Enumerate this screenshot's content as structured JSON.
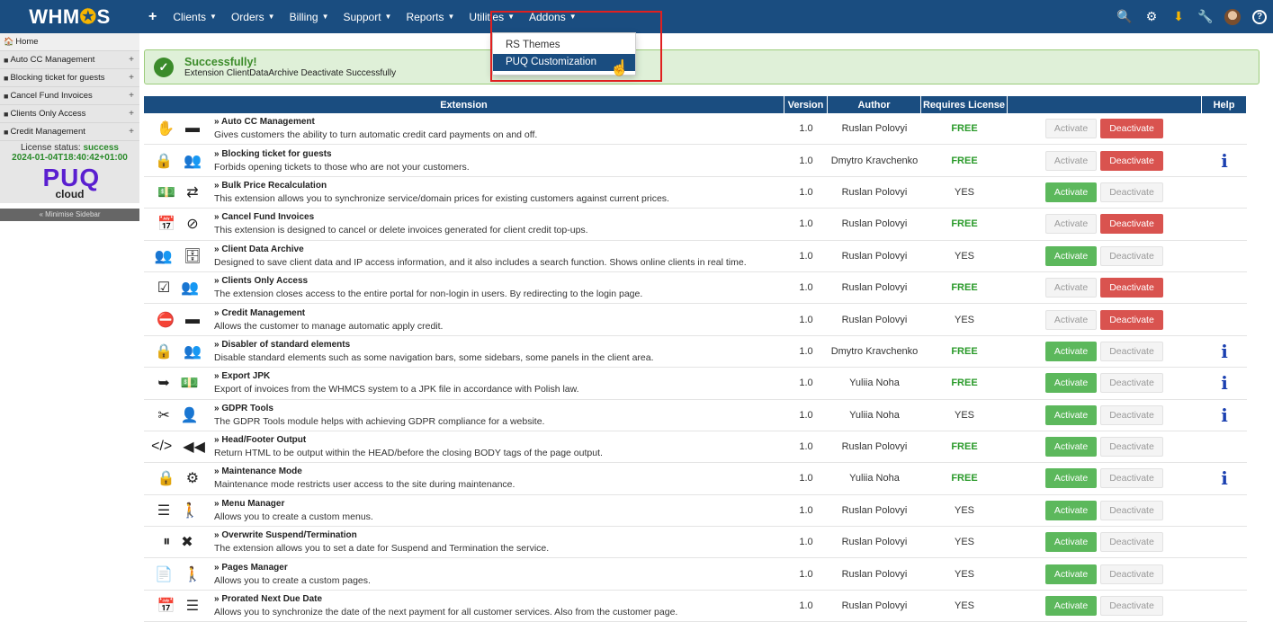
{
  "nav": {
    "logo": "WHM",
    "logo_tail": "S",
    "plus": "+",
    "items": [
      "Clients",
      "Orders",
      "Billing",
      "Support",
      "Reports",
      "Utilities",
      "Addons"
    ],
    "right_icons": [
      "search-icon",
      "cogs-icon",
      "download-icon",
      "wrench-icon",
      "avatar",
      "help-icon"
    ]
  },
  "addons_dropdown": [
    "RS Themes",
    "PUQ Customization"
  ],
  "sidebar": {
    "home": "Home",
    "items": [
      {
        "label": "Auto CC Management",
        "icon": "hand-card-icon"
      },
      {
        "label": "Blocking ticket for guests",
        "icon": "lock-users-icon"
      },
      {
        "label": "Cancel Fund Invoices",
        "icon": "calendar-ban-icon"
      },
      {
        "label": "Clients Only Access",
        "icon": "check-users-icon"
      },
      {
        "label": "Credit Management",
        "icon": "minus-card-icon"
      }
    ],
    "license_label": "License status:",
    "license_status": "success",
    "license_date": "2024-01-04T18:40:42+01:00",
    "brand_top": "PUQ",
    "brand_bottom": "cloud",
    "minimise": "« Minimise Sidebar"
  },
  "alert": {
    "title": "Successfully!",
    "message": "Extension ClientDataArchive Deactivate Successfully"
  },
  "table": {
    "headers": [
      "Extension",
      "Version",
      "Author",
      "Requires License",
      "",
      "Help"
    ],
    "activate_label": "Activate",
    "deactivate_label": "Deactivate",
    "rows": [
      {
        "icons": [
          "✋",
          "▬"
        ],
        "name": "» Auto CC Management",
        "desc": "Gives customers the ability to turn automatic credit card payments on and off.",
        "version": "1.0",
        "author": "Ruslan Polovyi",
        "license": "FREE",
        "active": true,
        "help": false
      },
      {
        "icons": [
          "🔒",
          "👥"
        ],
        "name": "» Blocking ticket for guests",
        "desc": "Forbids opening tickets to those who are not your customers.",
        "version": "1.0",
        "author": "Dmytro Kravchenko",
        "license": "FREE",
        "active": true,
        "help": true
      },
      {
        "icons": [
          "💵",
          "⇄"
        ],
        "name": "» Bulk Price Recalculation",
        "desc": "This extension allows you to synchronize service/domain prices for existing customers against current prices.",
        "version": "1.0",
        "author": "Ruslan Polovyi",
        "license": "YES",
        "active": false,
        "help": false
      },
      {
        "icons": [
          "📅",
          "⊘"
        ],
        "name": "» Cancel Fund Invoices",
        "desc": "This extension is designed to cancel or delete invoices generated for client credit top-ups.",
        "version": "1.0",
        "author": "Ruslan Polovyi",
        "license": "FREE",
        "active": true,
        "help": false
      },
      {
        "icons": [
          "👥",
          "🗄"
        ],
        "name": "» Client Data Archive",
        "desc": "Designed to save client data and IP access information, and it also includes a search function. Shows online clients in real time.",
        "version": "1.0",
        "author": "Ruslan Polovyi",
        "license": "YES",
        "active": false,
        "help": false
      },
      {
        "icons": [
          "☑",
          "👥"
        ],
        "name": "» Clients Only Access",
        "desc": "The extension closes access to the entire portal for non-login in users. By redirecting to the login page.",
        "version": "1.0",
        "author": "Ruslan Polovyi",
        "license": "FREE",
        "active": true,
        "help": false
      },
      {
        "icons": [
          "⛔",
          "▬"
        ],
        "name": "» Credit Management",
        "desc": "Allows the customer to manage automatic apply credit.",
        "version": "1.0",
        "author": "Ruslan Polovyi",
        "license": "YES",
        "active": true,
        "help": false
      },
      {
        "icons": [
          "🔒",
          "👥"
        ],
        "name": "» Disabler of standard elements",
        "desc": "Disable standard elements such as some navigation bars, some sidebars, some panels in the client area.",
        "version": "1.0",
        "author": "Dmytro Kravchenko",
        "license": "FREE",
        "active": false,
        "help": true
      },
      {
        "icons": [
          "➥",
          "💵"
        ],
        "name": "» Export JPK",
        "desc": "Export of invoices from the WHMCS system to a JPK file in accordance with Polish law.",
        "version": "1.0",
        "author": "Yuliia Noha",
        "license": "FREE",
        "active": false,
        "help": true
      },
      {
        "icons": [
          "✂",
          "👤"
        ],
        "name": "» GDPR Tools",
        "desc": "The GDPR Tools module helps with achieving GDPR compliance for a website.",
        "version": "1.0",
        "author": "Yuliia Noha",
        "license": "YES",
        "active": false,
        "help": true
      },
      {
        "icons": [
          "</>",
          "◀◀"
        ],
        "name": "» Head/Footer Output",
        "desc": "Return HTML to be output within the HEAD/before the closing BODY tags of the page output.",
        "version": "1.0",
        "author": "Ruslan Polovyi",
        "license": "FREE",
        "active": false,
        "help": false
      },
      {
        "icons": [
          "🔒",
          "⚙"
        ],
        "name": "» Maintenance Mode",
        "desc": "Maintenance mode restricts user access to the site during maintenance.",
        "version": "1.0",
        "author": "Yuliia Noha",
        "license": "FREE",
        "active": false,
        "help": true
      },
      {
        "icons": [
          "☰",
          "🚶"
        ],
        "name": "» Menu Manager",
        "desc": "Allows you to create a custom menus.",
        "version": "1.0",
        "author": "Ruslan Polovyi",
        "license": "YES",
        "active": false,
        "help": false
      },
      {
        "icons": [
          "⏸",
          "✖"
        ],
        "name": "» Overwrite Suspend/Termination",
        "desc": "The extension allows you to set a date for Suspend and Termination the service.",
        "version": "1.0",
        "author": "Ruslan Polovyi",
        "license": "YES",
        "active": false,
        "help": false
      },
      {
        "icons": [
          "📄",
          "🚶"
        ],
        "name": "» Pages Manager",
        "desc": "Allows you to create a custom pages.",
        "version": "1.0",
        "author": "Ruslan Polovyi",
        "license": "YES",
        "active": false,
        "help": false
      },
      {
        "icons": [
          "📅",
          "☰"
        ],
        "name": "» Prorated Next Due Date",
        "desc": "Allows you to synchronize the date of the next payment for all customer services. Also from the customer page.",
        "version": "1.0",
        "author": "Ruslan Polovyi",
        "license": "YES",
        "active": false,
        "help": false
      }
    ]
  },
  "colors": {
    "nav_bg": "#1a4d80",
    "green": "#5cb85c",
    "red": "#d9534f",
    "free": "#2a9a2a",
    "highlight": "#e02020"
  }
}
